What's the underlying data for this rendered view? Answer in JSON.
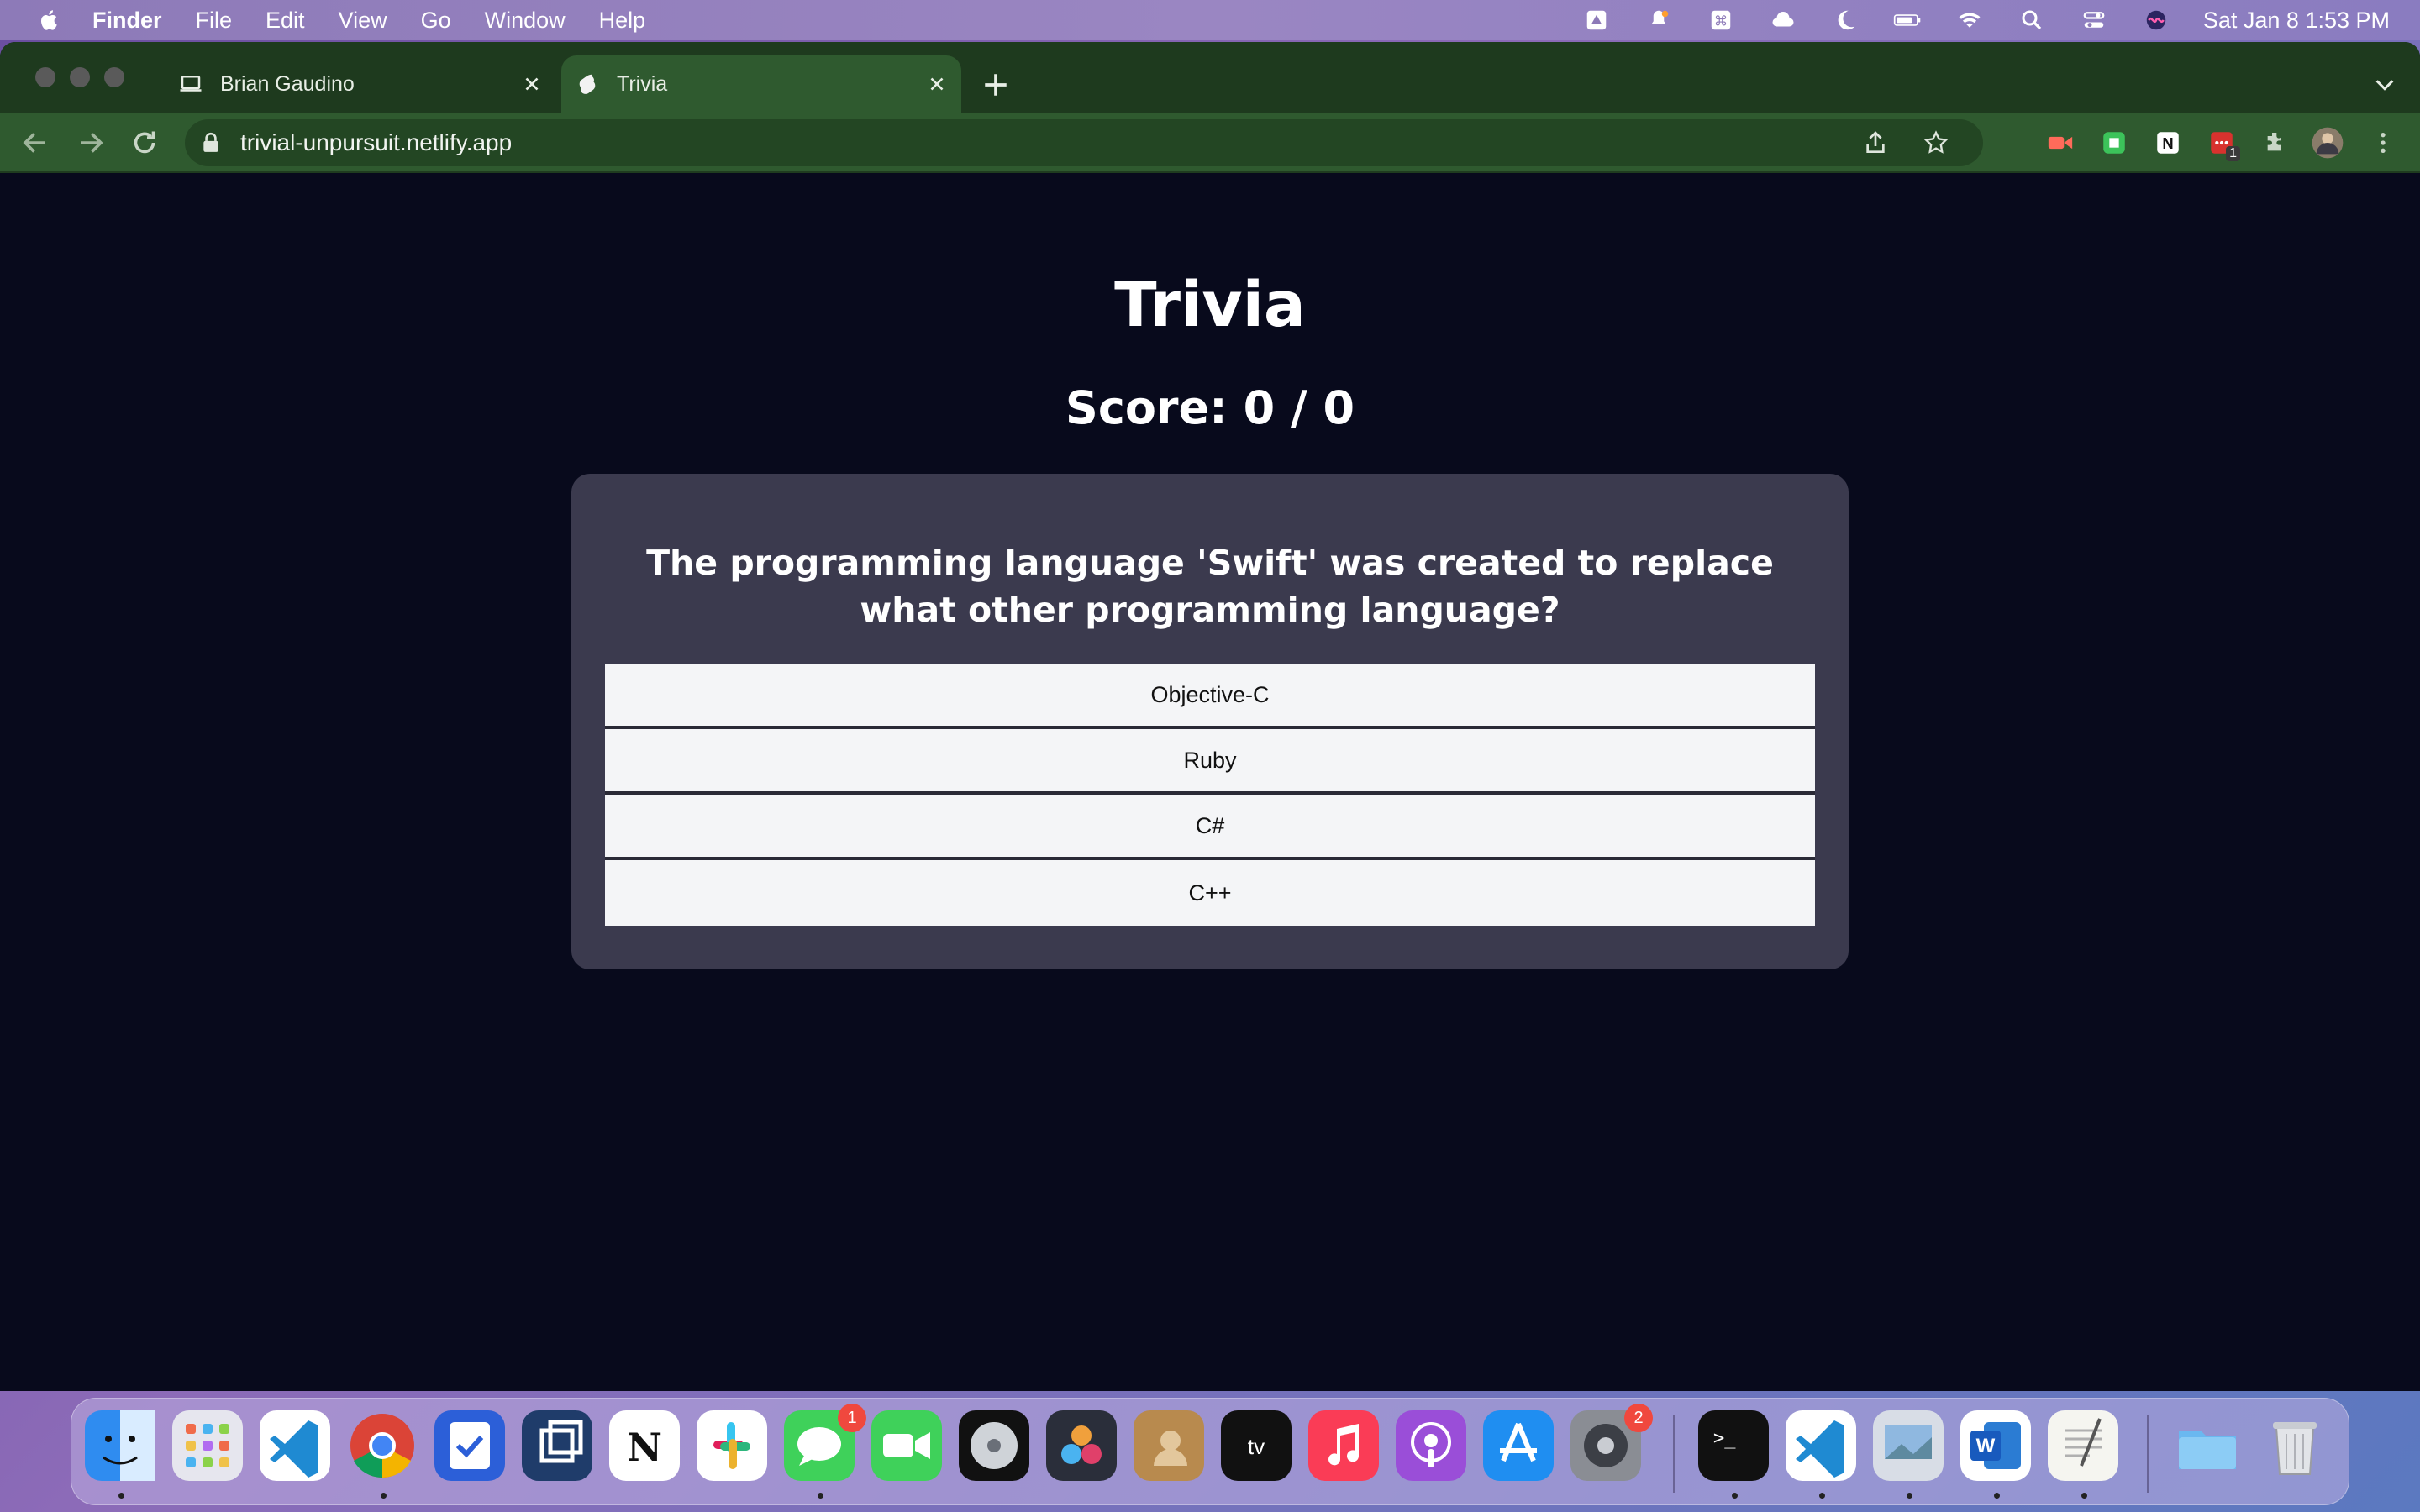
{
  "menubar": {
    "app_name": "Finder",
    "items": [
      "File",
      "Edit",
      "View",
      "Go",
      "Window",
      "Help"
    ],
    "clock": "Sat Jan 8  1:53 PM"
  },
  "browser": {
    "tabs": [
      {
        "title": "Brian Gaudino",
        "active": false
      },
      {
        "title": "Trivia",
        "active": true
      }
    ],
    "url": "trivial-unpursuit.netlify.app",
    "extension_badge": "1"
  },
  "page": {
    "title": "Trivia",
    "score": {
      "label": "Score: ",
      "correct": "0",
      "separator": " / ",
      "total": "0"
    },
    "question": "The programming language 'Swift' was created to replace what other programming language?",
    "answers": [
      "Objective-C",
      "Ruby",
      "C#",
      "C++"
    ]
  },
  "dock": {
    "messages_badge": "1",
    "settings_badge": "2",
    "apps": [
      "finder",
      "launchpad",
      "vscode",
      "chrome",
      "tasks",
      "screens",
      "notion",
      "slack",
      "messages",
      "facetime",
      "logic",
      "davinci-resolve",
      "contacts",
      "apple-tv",
      "music",
      "podcasts",
      "app-store",
      "system-preferences",
      "terminal",
      "vscode",
      "preview",
      "word",
      "textedit",
      "downloads-folder",
      "trash"
    ]
  },
  "colors": {
    "page_background": "#080a1c",
    "card_background": "#3b3a4e",
    "answer_background": "#f4f5f7",
    "browser_frame": "#2f5a2f"
  }
}
